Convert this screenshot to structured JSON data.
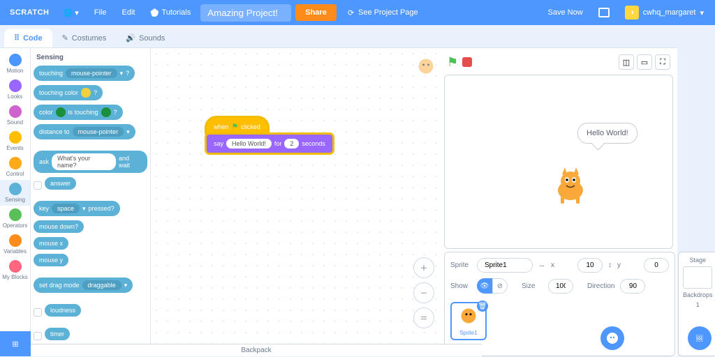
{
  "menu": {
    "logo": "SCRATCH",
    "file": "File",
    "edit": "Edit",
    "tutorials": "Tutorials",
    "project_title": "Amazing Project!",
    "share": "Share",
    "see_project": "See Project Page",
    "save_now": "Save Now",
    "username": "cwhq_margaret"
  },
  "tabs": {
    "code": "Code",
    "costumes": "Costumes",
    "sounds": "Sounds"
  },
  "categories": {
    "motion": "Motion",
    "looks": "Looks",
    "sound": "Sound",
    "events": "Events",
    "control": "Control",
    "sensing": "Sensing",
    "operators": "Operators",
    "variables": "Variables",
    "myblocks": "My Blocks"
  },
  "palette": {
    "heading": "Sensing",
    "touching": "touching",
    "mouse_pointer": "mouse-pointer",
    "q": "?",
    "touching_color": "touching color",
    "color": "color",
    "is_touching": "is touching",
    "distance_to": "distance to",
    "ask": "ask",
    "ask_default": "What's your name?",
    "and_wait": "and wait",
    "answer": "answer",
    "key": "key",
    "space": "space",
    "pressed": "pressed?",
    "mouse_down": "mouse down?",
    "mouse_x": "mouse x",
    "mouse_y": "mouse y",
    "set_drag_mode": "set drag mode",
    "draggable": "draggable",
    "loudness": "loudness",
    "timer": "timer"
  },
  "script": {
    "when": "when",
    "clicked": "clicked",
    "say": "say",
    "for": "for",
    "seconds": "seconds",
    "hello": "Hello World!",
    "two": "2"
  },
  "stage": {
    "speech": "Hello World!"
  },
  "sprite_info": {
    "sprite_lbl": "Sprite",
    "sprite_name": "Sprite1",
    "x_lbl": "x",
    "x_val": "10",
    "y_lbl": "y",
    "y_val": "0",
    "show_lbl": "Show",
    "size_lbl": "Size",
    "size_val": "100",
    "direction_lbl": "Direction",
    "direction_val": "90",
    "tile_name": "Sprite1"
  },
  "stage_thumb": {
    "label": "Stage",
    "backdrops": "Backdrops",
    "count": "1"
  },
  "backpack": "Backpack"
}
